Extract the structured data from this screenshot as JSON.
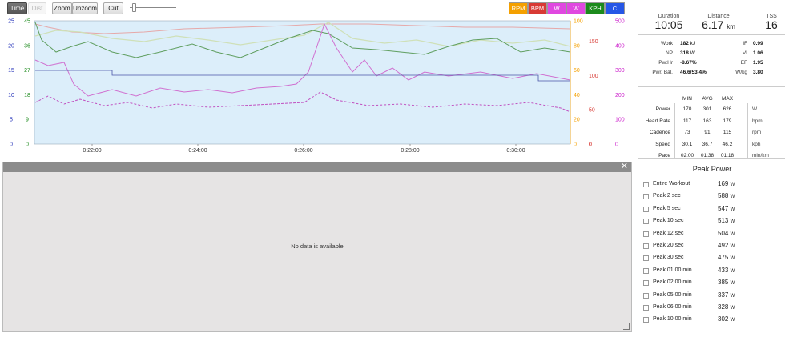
{
  "toolbar": {
    "time_label": "Time",
    "dist_label": "Dist",
    "zoom_label": "Zoom",
    "unzoom_label": "Unzoom",
    "cut_label": "Cut",
    "channels": [
      {
        "label": "RPM",
        "color": "#f4a000"
      },
      {
        "label": "BPM",
        "color": "#d83a34"
      },
      {
        "label": "W",
        "color": "#e048e0"
      },
      {
        "label": "W",
        "color": "#e048e0"
      },
      {
        "label": "KPH",
        "color": "#1c8a1c"
      },
      {
        "label": "C",
        "color": "#2656e6"
      }
    ]
  },
  "chart_data": {
    "type": "line",
    "x_ticks": [
      "0:22:00",
      "0:24:00",
      "0:26:00",
      "0:28:00",
      "0:30:00"
    ],
    "left_axes": [
      {
        "color": "#2230b8",
        "ticks": [
          "0",
          "5",
          "10",
          "15",
          "20",
          "25"
        ]
      },
      {
        "color": "#1c8a1c",
        "ticks": [
          "0",
          "9",
          "18",
          "27",
          "36",
          "45"
        ]
      }
    ],
    "right_axes": [
      {
        "color": "#f4a000",
        "ticks": [
          "0",
          "20",
          "40",
          "60",
          "80",
          "100"
        ]
      },
      {
        "color": "#d83a34",
        "ticks": [
          "0",
          "50",
          "100",
          "150"
        ]
      },
      {
        "color": "#cc20cc",
        "ticks": [
          "100",
          "200",
          "300",
          "400",
          "500"
        ]
      }
    ],
    "background": "#dceefa",
    "series_colors": [
      "#e6a8a8",
      "#5f9e5f",
      "#cfe0b8",
      "#d070d0",
      "#c050c0",
      "#4a55a8"
    ],
    "ylim": [
      0,
      1
    ]
  },
  "panel": {
    "message": "No data is available",
    "close_glyph": "✕"
  },
  "summary": {
    "duration_label": "Duration",
    "duration_value": "10:05",
    "distance_label": "Distance",
    "distance_value": "6.17",
    "distance_unit": "km",
    "tss_label": "TSS",
    "tss_value": "16"
  },
  "metrics": [
    {
      "label": "Work",
      "value": "182",
      "unit": "kJ",
      "label2": "IF",
      "value2": "0.99"
    },
    {
      "label": "NP",
      "value": "318",
      "unit": "W",
      "label2": "VI",
      "value2": "1.06"
    },
    {
      "label": "Pw:Hr",
      "value": "-8.67%",
      "unit": "",
      "label2": "EF",
      "value2": "1.95"
    },
    {
      "label": "Pwr. Bal.",
      "value": "46.6/53.4%",
      "unit": "",
      "label2": "W/kg",
      "value2": "3.80"
    }
  ],
  "stats": {
    "headers": [
      "MIN",
      "AVG",
      "MAX"
    ],
    "rows": [
      {
        "label": "Power",
        "min": "170",
        "avg": "301",
        "max": "626",
        "unit": "W"
      },
      {
        "label": "Heart Rate",
        "min": "117",
        "avg": "163",
        "max": "179",
        "unit": "bpm"
      },
      {
        "label": "Cadence",
        "min": "73",
        "avg": "91",
        "max": "115",
        "unit": "rpm"
      },
      {
        "label": "Speed",
        "min": "30.1",
        "avg": "36.7",
        "max": "46.2",
        "unit": "kph"
      },
      {
        "label": "Pace",
        "min": "02:00",
        "avg": "01:38",
        "max": "01:18",
        "unit": "min/km"
      }
    ]
  },
  "peak": {
    "title": "Peak Power",
    "rows": [
      {
        "label": "Entire Workout",
        "value": "169",
        "unit": "W"
      },
      {
        "label": "Peak 2 sec",
        "value": "588",
        "unit": "W"
      },
      {
        "label": "Peak 5 sec",
        "value": "547",
        "unit": "W"
      },
      {
        "label": "Peak 10 sec",
        "value": "513",
        "unit": "W"
      },
      {
        "label": "Peak 12 sec",
        "value": "504",
        "unit": "W"
      },
      {
        "label": "Peak 20 sec",
        "value": "492",
        "unit": "W"
      },
      {
        "label": "Peak 30 sec",
        "value": "475",
        "unit": "W"
      },
      {
        "label": "Peak 01:00 min",
        "value": "433",
        "unit": "W"
      },
      {
        "label": "Peak 02:00 min",
        "value": "385",
        "unit": "W"
      },
      {
        "label": "Peak 05:00 min",
        "value": "337",
        "unit": "W"
      },
      {
        "label": "Peak 06:00 min",
        "value": "328",
        "unit": "W"
      },
      {
        "label": "Peak 10:00 min",
        "value": "302",
        "unit": "W"
      }
    ]
  }
}
